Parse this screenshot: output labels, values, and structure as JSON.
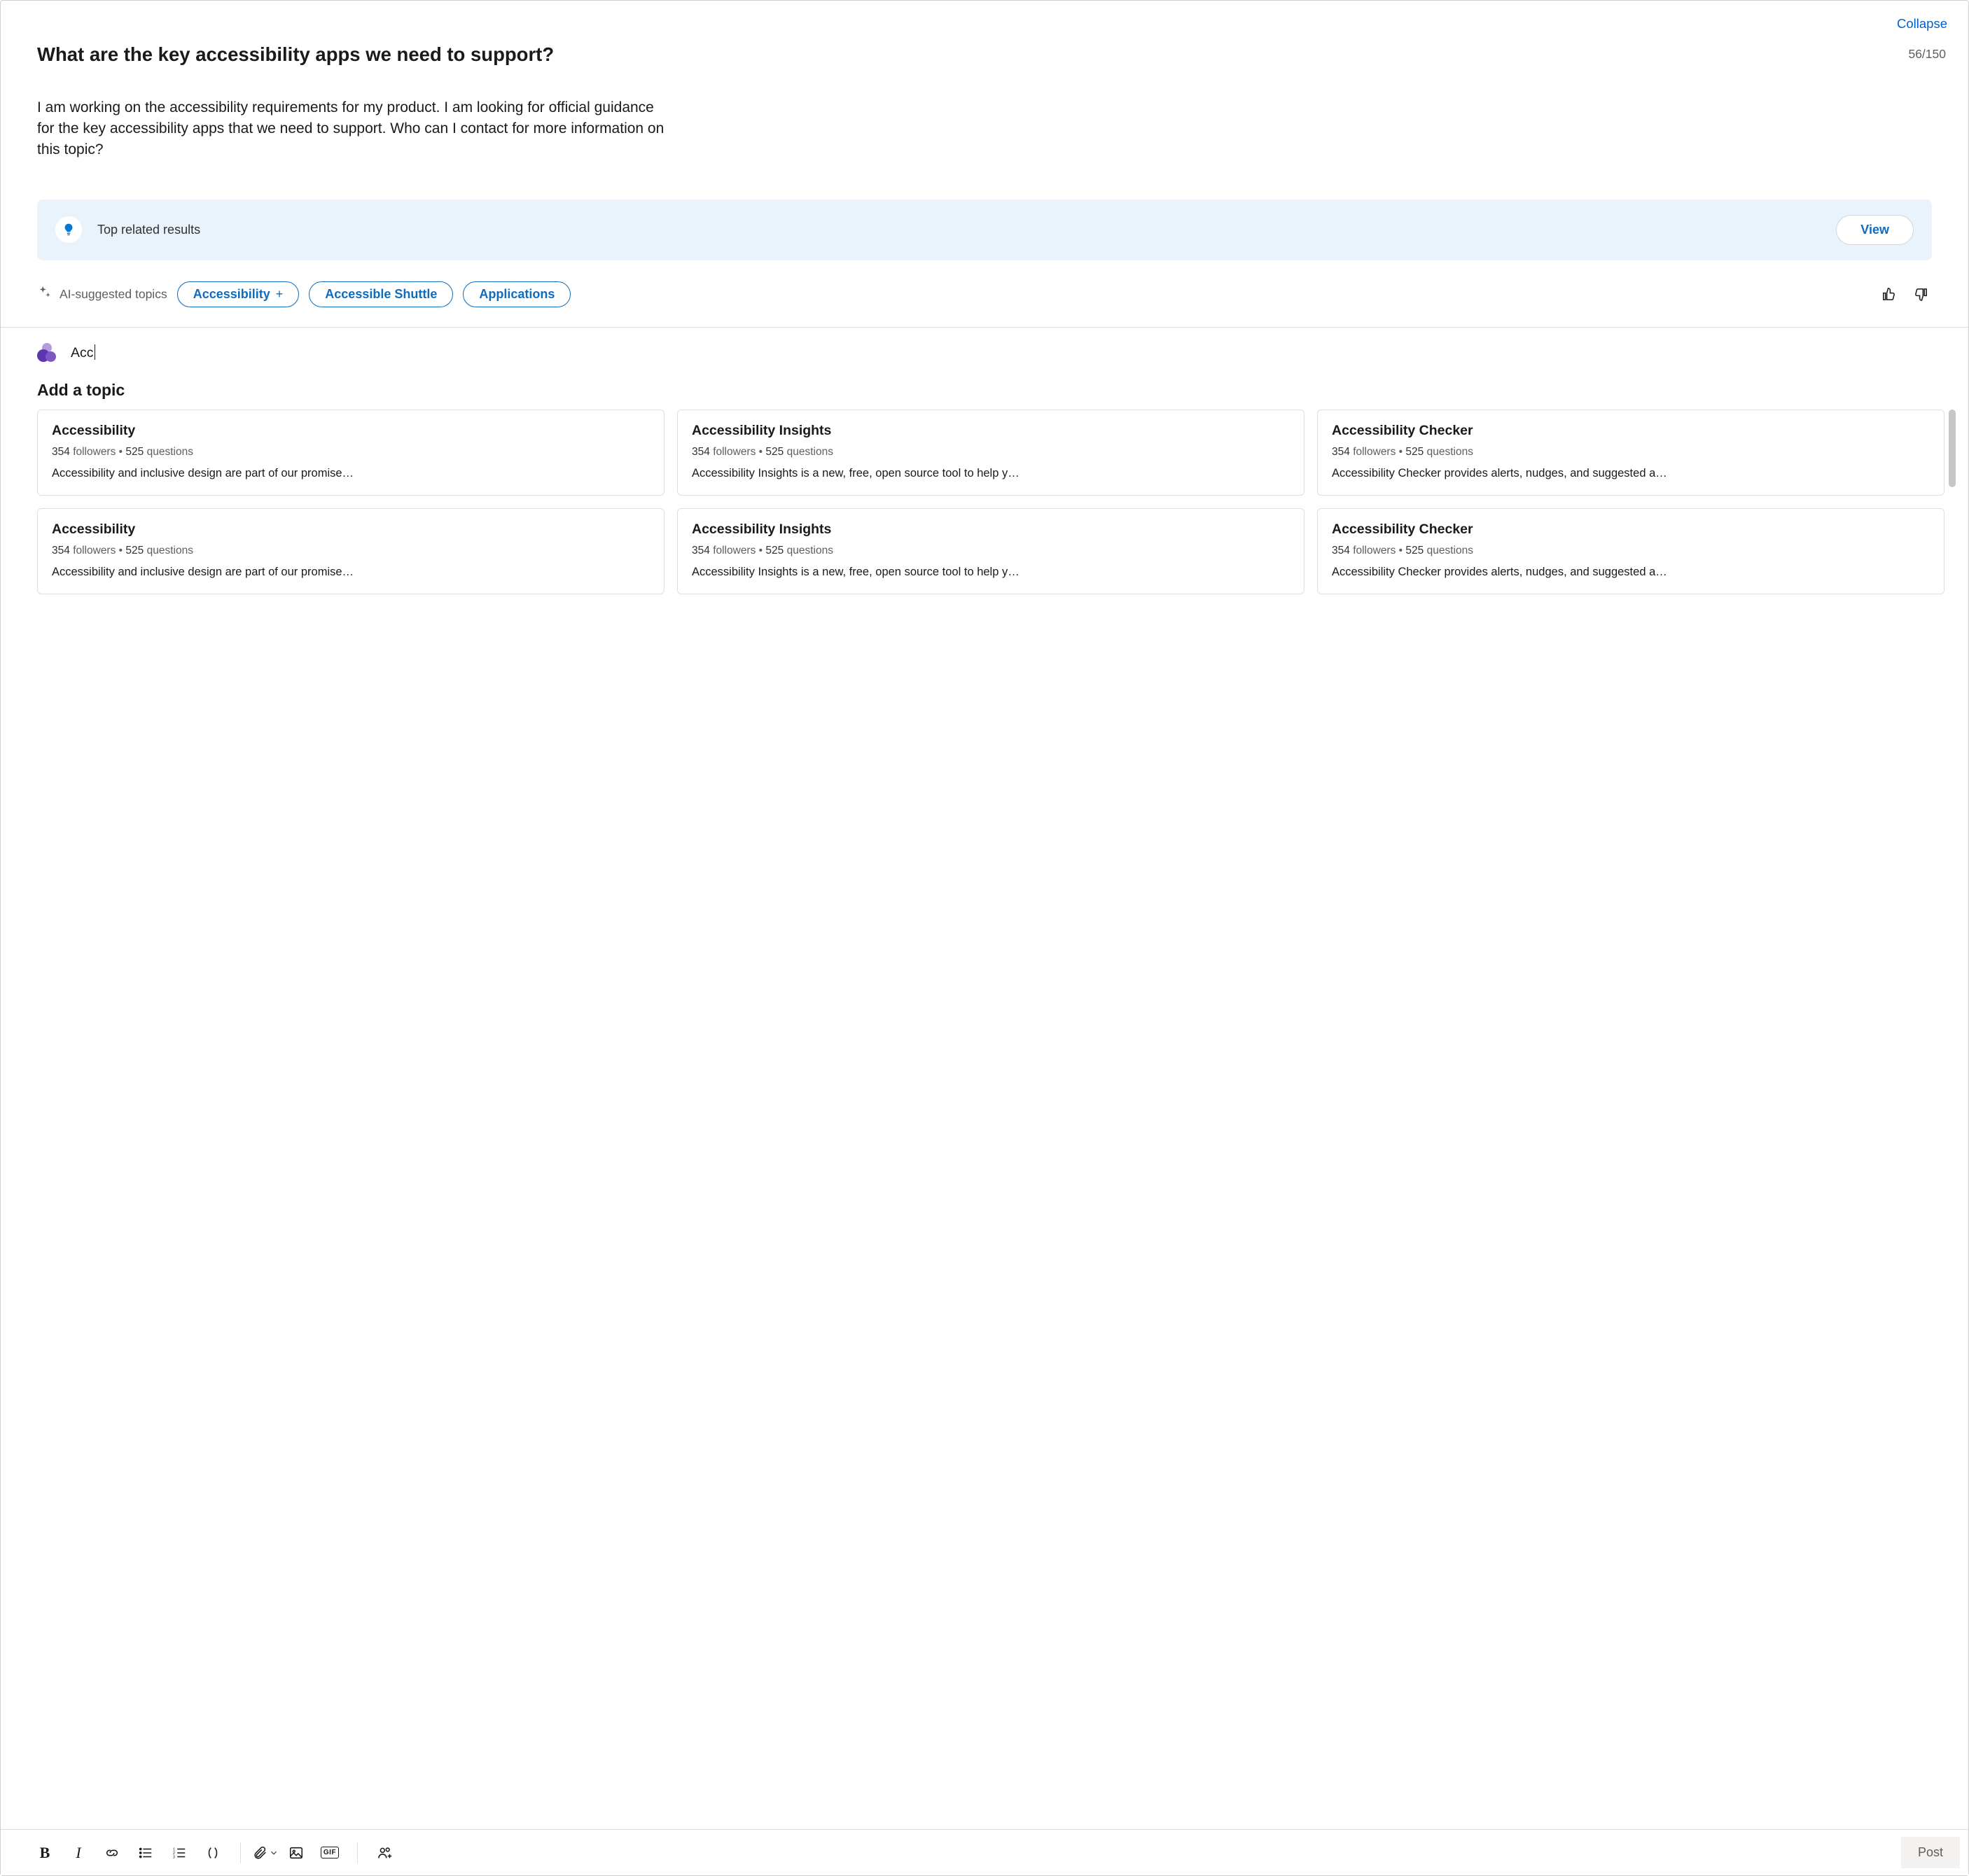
{
  "header": {
    "collapse_label": "Collapse",
    "title": "What are the key accessibility apps we need to support?",
    "char_count": "56/150"
  },
  "body_text": "I am working on the accessibility requirements for my product. I am looking for official guidance for the key accessibility apps that we need to support. Who can I contact for more information on this topic?",
  "related": {
    "label": "Top related results",
    "view_label": "View"
  },
  "ai_topics": {
    "label": "AI-suggested topics",
    "chips": [
      {
        "label": "Accessibility",
        "has_plus": true
      },
      {
        "label": "Accessible Shuttle",
        "has_plus": false
      },
      {
        "label": "Applications",
        "has_plus": false
      }
    ]
  },
  "topic_input": {
    "text": "Acc"
  },
  "add_topic_heading": "Add a topic",
  "meta_labels": {
    "followers": "followers",
    "questions": "questions"
  },
  "topic_cards": [
    {
      "title": "Accessibility",
      "followers": "354",
      "questions": "525",
      "desc": "Accessibility and inclusive design are part of our promise…"
    },
    {
      "title": "Accessibility Insights",
      "followers": "354",
      "questions": "525",
      "desc": "Accessibility Insights is a new, free, open source tool to help y…"
    },
    {
      "title": "Accessibility Checker",
      "followers": "354",
      "questions": "525",
      "desc": "Accessibility Checker provides alerts, nudges, and suggested a…"
    },
    {
      "title": "Accessibility",
      "followers": "354",
      "questions": "525",
      "desc": "Accessibility and inclusive design are part of our promise…"
    },
    {
      "title": "Accessibility Insights",
      "followers": "354",
      "questions": "525",
      "desc": "Accessibility Insights is a new, free, open source tool to help y…"
    },
    {
      "title": "Accessibility Checker",
      "followers": "354",
      "questions": "525",
      "desc": "Accessibility Checker provides alerts, nudges, and suggested a…"
    }
  ],
  "footer": {
    "post_label": "Post",
    "gif_label": "GIF"
  }
}
